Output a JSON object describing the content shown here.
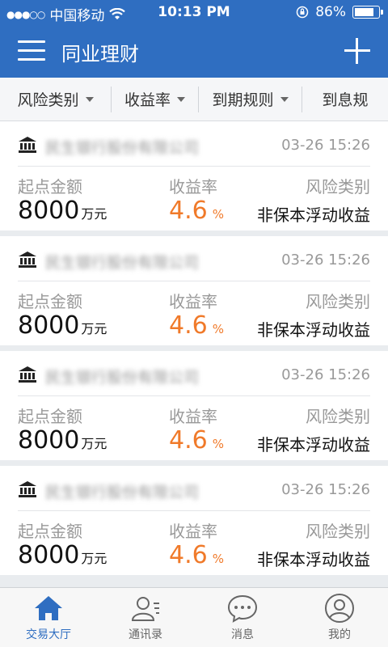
{
  "status_bar": {
    "carrier": "中国移动",
    "time": "10:13 PM",
    "battery_text": "86%",
    "battery_level": 0.86
  },
  "nav": {
    "title": "同业理财"
  },
  "filters": [
    {
      "label": "风险类别"
    },
    {
      "label": "收益率"
    },
    {
      "label": "到期规则"
    },
    {
      "label": "到息规"
    }
  ],
  "cards": [
    {
      "bank_name": "民生银行股份有限公司",
      "date": "03-26 15:26",
      "amount_label": "起点金额",
      "amount": "8000",
      "amount_unit": "万元",
      "rate_label": "收益率",
      "rate": "4.6",
      "rate_unit": "%",
      "risk_label": "风险类别",
      "risk": "非保本浮动收益"
    },
    {
      "bank_name": "民生银行股份有限公司",
      "date": "03-26 15:26",
      "amount_label": "起点金额",
      "amount": "8000",
      "amount_unit": "万元",
      "rate_label": "收益率",
      "rate": "4.6",
      "rate_unit": "%",
      "risk_label": "风险类别",
      "risk": "非保本浮动收益"
    },
    {
      "bank_name": "民生银行股份有限公司",
      "date": "03-26 15:26",
      "amount_label": "起点金额",
      "amount": "8000",
      "amount_unit": "万元",
      "rate_label": "收益率",
      "rate": "4.6",
      "rate_unit": "%",
      "risk_label": "风险类别",
      "risk": "非保本浮动收益"
    },
    {
      "bank_name": "民生银行股份有限公司",
      "date": "03-26 15:26",
      "amount_label": "起点金额",
      "amount": "8000",
      "amount_unit": "万元",
      "rate_label": "收益率",
      "rate": "4.6",
      "rate_unit": "%",
      "risk_label": "风险类别",
      "risk": "非保本浮动收益"
    }
  ],
  "tabs": [
    {
      "label": "交易大厅",
      "icon": "home-icon",
      "active": true
    },
    {
      "label": "通讯录",
      "icon": "contacts-icon",
      "active": false
    },
    {
      "label": "消息",
      "icon": "message-icon",
      "active": false
    },
    {
      "label": "我的",
      "icon": "profile-icon",
      "active": false
    }
  ],
  "colors": {
    "brand": "#2f6ec1",
    "rate": "#f07a2a"
  }
}
